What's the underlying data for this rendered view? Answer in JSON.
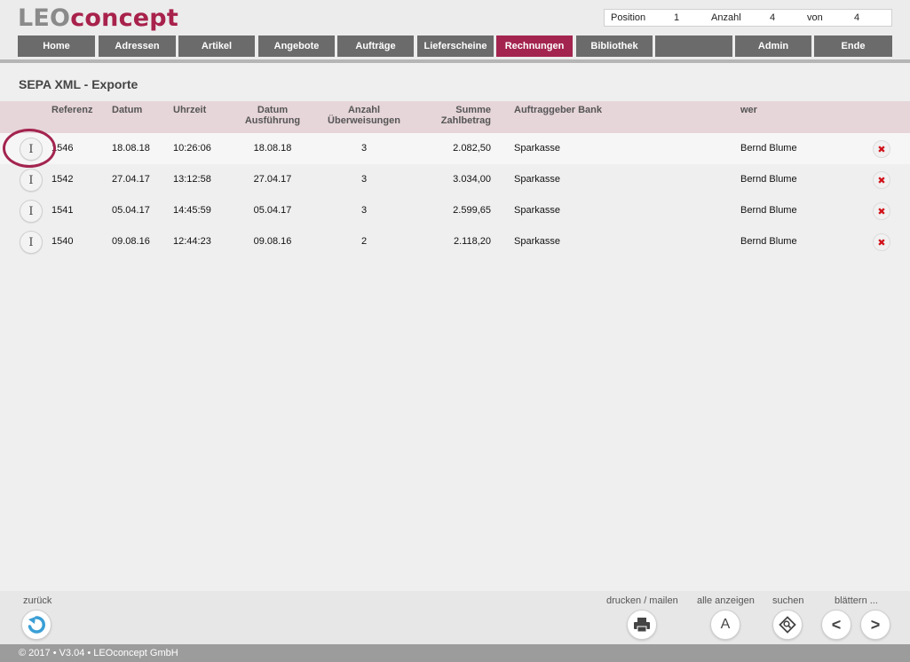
{
  "header": {
    "logo_part1": "LEO",
    "logo_part2": "concept",
    "status": {
      "position_label": "Position",
      "position_value": "1",
      "count_label": "Anzahl",
      "count_value": "4",
      "of_label": "von",
      "of_value": "4"
    }
  },
  "nav": {
    "items": [
      {
        "label": "Home"
      },
      {
        "label": "Adressen"
      },
      {
        "label": "Artikel"
      },
      {
        "label": "Angebote"
      },
      {
        "label": "Aufträge"
      },
      {
        "label": "Lieferscheine"
      },
      {
        "label": "Rechnungen"
      },
      {
        "label": "Bibliothek"
      },
      {
        "label": ""
      },
      {
        "label": "Admin"
      },
      {
        "label": "Ende"
      }
    ],
    "active_index": 6
  },
  "page": {
    "title": "SEPA XML - Exporte"
  },
  "table": {
    "headers": {
      "referenz": "Referenz",
      "datum": "Datum",
      "uhrzeit": "Uhrzeit",
      "datum_ausf_1": "Datum",
      "datum_ausf_2": "Ausführung",
      "anzahl_1": "Anzahl",
      "anzahl_2": "Überweisungen",
      "summe_1": "Summe",
      "summe_2": "Zahlbetrag",
      "bank": "Auftraggeber Bank",
      "wer": "wer"
    },
    "info_icon_glyph": "I",
    "delete_icon_glyph": "✖",
    "rows": [
      {
        "referenz": "1546",
        "datum": "18.08.18",
        "uhrzeit": "10:26:06",
        "ausfuehrung": "18.08.18",
        "anzahl": "3",
        "summe": "2.082,50",
        "bank": "Sparkasse",
        "wer": "Bernd Blume"
      },
      {
        "referenz": "1542",
        "datum": "27.04.17",
        "uhrzeit": "13:12:58",
        "ausfuehrung": "27.04.17",
        "anzahl": "3",
        "summe": "3.034,00",
        "bank": "Sparkasse",
        "wer": "Bernd Blume"
      },
      {
        "referenz": "1541",
        "datum": "05.04.17",
        "uhrzeit": "14:45:59",
        "ausfuehrung": "05.04.17",
        "anzahl": "3",
        "summe": "2.599,65",
        "bank": "Sparkasse",
        "wer": "Bernd Blume"
      },
      {
        "referenz": "1540",
        "datum": "09.08.16",
        "uhrzeit": "12:44:23",
        "ausfuehrung": "09.08.16",
        "anzahl": "2",
        "summe": "2.118,20",
        "bank": "Sparkasse",
        "wer": "Bernd Blume"
      }
    ]
  },
  "toolbar": {
    "back_label": "zurück",
    "print_label": "drucken / mailen",
    "show_all_label": "alle anzeigen",
    "show_all_glyph": "A",
    "search_label": "suchen",
    "page_label": "blättern ...",
    "prev_glyph": "<",
    "next_glyph": ">"
  },
  "footer": {
    "copyright": "© 2017 • V3.04 • LEOconcept GmbH"
  },
  "colors": {
    "accent": "#a3244f",
    "nav_bg": "#6b6b6b",
    "header_row_bg": "#e6d5d9",
    "delete_red": "#d0121a",
    "back_blue": "#3a9fd6"
  }
}
